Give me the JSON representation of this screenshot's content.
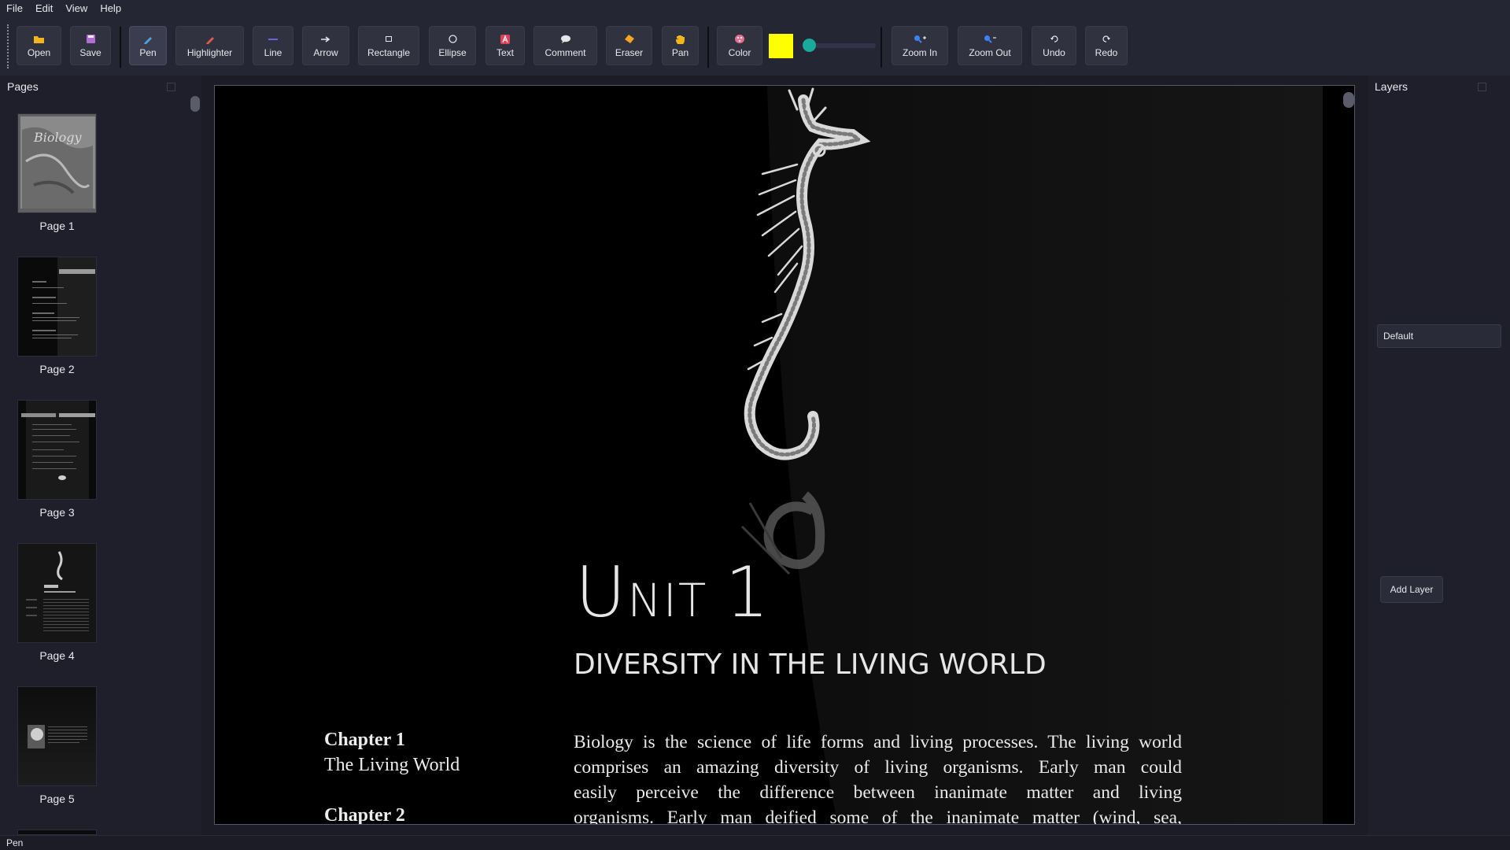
{
  "menu": [
    "File",
    "Edit",
    "View",
    "Help"
  ],
  "toolbar": {
    "open": "Open",
    "save": "Save",
    "pen": "Pen",
    "highlighter": "Highlighter",
    "line": "Line",
    "arrow": "Arrow",
    "rectangle": "Rectangle",
    "ellipse": "Ellipse",
    "text": "Text",
    "comment": "Comment",
    "eraser": "Eraser",
    "pan": "Pan",
    "color": "Color",
    "color_value": "#ffff00",
    "zoom_in": "Zoom In",
    "zoom_out": "Zoom Out",
    "undo": "Undo",
    "redo": "Redo",
    "active_tool": "Pen"
  },
  "pages_panel": {
    "title": "Pages",
    "pages": [
      "Page 1",
      "Page 2",
      "Page 3",
      "Page 4",
      "Page 5"
    ]
  },
  "layers_panel": {
    "title": "Layers",
    "layers": [
      "Default"
    ],
    "add_button": "Add Layer"
  },
  "document": {
    "unit_u": "U",
    "unit_rest": "NIT",
    "unit_num": "1",
    "subtitle": "DIVERSITY IN THE LIVING WORLD",
    "chapter1_heading": "Chapter 1",
    "chapter1_title": "The Living World",
    "chapter2_heading": "Chapter 2",
    "body_lines": [
      "Biology is the science of life forms and living processes. The living world",
      "comprises an amazing diversity of living organisms. Early man could",
      "easily perceive the difference between inanimate matter and living",
      "organisms. Early man deified some of the inanimate matter (wind, sea,"
    ]
  },
  "status": "Pen"
}
